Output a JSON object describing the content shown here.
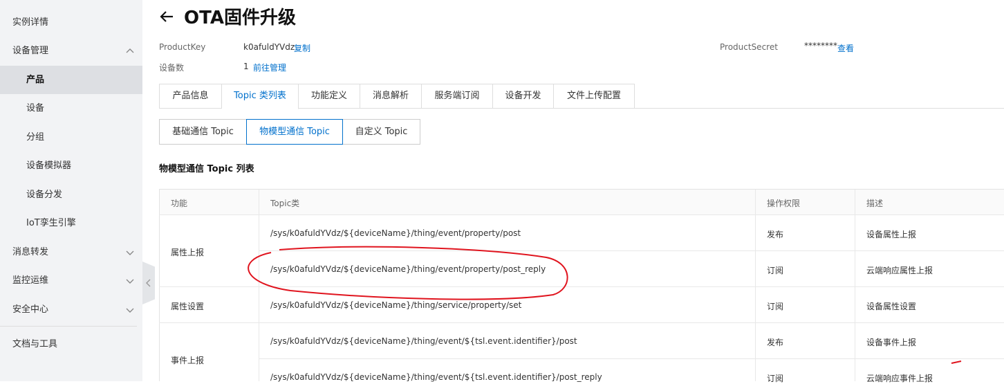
{
  "sidebar": {
    "items": [
      {
        "label": "实例详情"
      },
      {
        "label": "设备管理"
      },
      {
        "label": "产品"
      },
      {
        "label": "设备"
      },
      {
        "label": "分组"
      },
      {
        "label": "设备模拟器"
      },
      {
        "label": "设备分发"
      },
      {
        "label": "IoT孪生引擎"
      },
      {
        "label": "消息转发"
      },
      {
        "label": "监控运维"
      },
      {
        "label": "安全中心"
      },
      {
        "label": "文档与工具"
      }
    ]
  },
  "header": {
    "title": "OTA固件升级",
    "product_key_label": "ProductKey",
    "product_key_value": "k0afuldYVdz",
    "copy_link": "复制",
    "product_secret_label": "ProductSecret",
    "product_secret_value": "********",
    "view_link": "查看",
    "device_count_label": "设备数",
    "device_count_value": "1",
    "manage_link": "前往管理"
  },
  "tabs": [
    {
      "label": "产品信息"
    },
    {
      "label": "Topic 类列表"
    },
    {
      "label": "功能定义"
    },
    {
      "label": "消息解析"
    },
    {
      "label": "服务端订阅"
    },
    {
      "label": "设备开发"
    },
    {
      "label": "文件上传配置"
    }
  ],
  "subtabs": [
    {
      "label": "基础通信 Topic"
    },
    {
      "label": "物模型通信 Topic"
    },
    {
      "label": "自定义 Topic"
    }
  ],
  "section_title": "物模型通信 Topic 列表",
  "table": {
    "headers": [
      "功能",
      "Topic类",
      "操作权限",
      "描述"
    ],
    "groups": [
      {
        "name": "属性上报"
      },
      {
        "name": "属性设置"
      },
      {
        "name": "事件上报"
      }
    ],
    "rows": [
      {
        "topic": "/sys/k0afuldYVdz/${deviceName}/thing/event/property/post",
        "permission": "发布",
        "desc": "设备属性上报"
      },
      {
        "topic": "/sys/k0afuldYVdz/${deviceName}/thing/event/property/post_reply",
        "permission": "订阅",
        "desc": "云端响应属性上报"
      },
      {
        "topic": "/sys/k0afuldYVdz/${deviceName}/thing/service/property/set",
        "permission": "订阅",
        "desc": "设备属性设置"
      },
      {
        "topic": "/sys/k0afuldYVdz/${deviceName}/thing/event/${tsl.event.identifier}/post",
        "permission": "发布",
        "desc": "设备事件上报"
      },
      {
        "topic": "/sys/k0afuldYVdz/${deviceName}/thing/event/${tsl.event.identifier}/post_reply",
        "permission": "订阅",
        "desc": "云端响应事件上报"
      }
    ]
  },
  "colors": {
    "accent": "#0070cc",
    "annotation": "#e0141e",
    "sidebar_bg": "#f2f3f5"
  }
}
